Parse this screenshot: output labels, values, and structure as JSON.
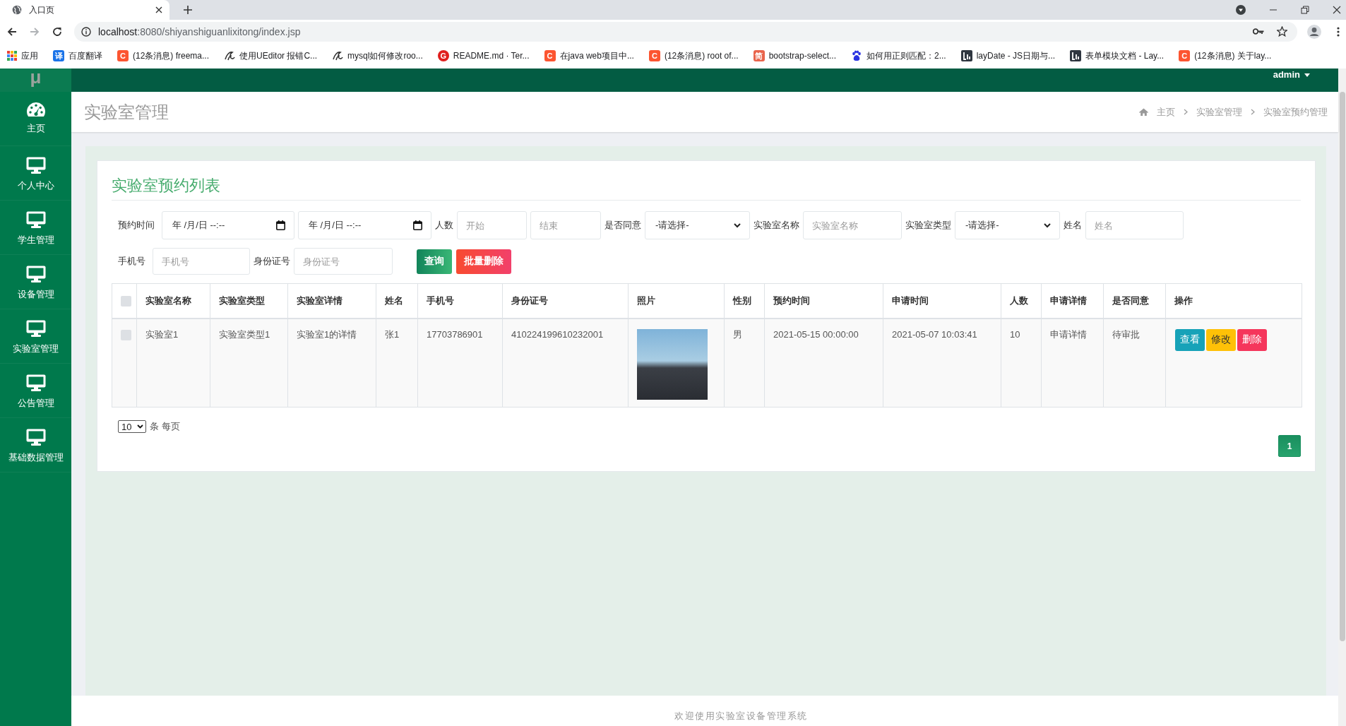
{
  "browser": {
    "tabs": [
      {
        "title": "入口页",
        "selected": true
      }
    ],
    "url": {
      "host": "localhost",
      "path": ":8080/shiyanshiguanlixitong/index.jsp"
    },
    "bookmarks": [
      {
        "kind": "apps",
        "label": "应用"
      },
      {
        "kind": "tile",
        "glyph": "译",
        "color": "#1a73e8",
        "label": "百度翻译"
      },
      {
        "kind": "tile",
        "glyph": "C",
        "color": "#fc5531",
        "label": "(12条消息) freema..."
      },
      {
        "kind": "swirl",
        "label": "使用UEditor 报错C..."
      },
      {
        "kind": "swirl",
        "label": "mysql如何修改roo..."
      },
      {
        "kind": "ring",
        "glyph": "G",
        "color": "#e0201e",
        "label": "README.md · Ter..."
      },
      {
        "kind": "tile",
        "glyph": "C",
        "color": "#fc5531",
        "label": "在java web项目中..."
      },
      {
        "kind": "tile",
        "glyph": "C",
        "color": "#fc5531",
        "label": "(12条消息) root of..."
      },
      {
        "kind": "tile",
        "glyph": "简",
        "color": "#e9644c",
        "label": "bootstrap-select..."
      },
      {
        "kind": "paw",
        "label": "如何用正则匹配：2..."
      },
      {
        "kind": "lay",
        "label": "layDate - JS日期与..."
      },
      {
        "kind": "lay",
        "label": "表单模块文档 - Lay..."
      },
      {
        "kind": "tile",
        "glyph": "C",
        "color": "#fc5531",
        "label": "(12条消息) 关于lay..."
      }
    ]
  },
  "topbar": {
    "logo": "μ",
    "user": "admin"
  },
  "sidebar": {
    "items": [
      {
        "kind": "gauge",
        "label": "主页",
        "selected": false
      },
      {
        "kind": "monitor",
        "label": "个人中心",
        "selected": false
      },
      {
        "kind": "monitor",
        "label": "学生管理",
        "selected": false
      },
      {
        "kind": "monitor",
        "label": "设备管理",
        "selected": false
      },
      {
        "kind": "monitor",
        "label": "实验室管理",
        "selected": false
      },
      {
        "kind": "monitor",
        "label": "公告管理",
        "selected": false
      },
      {
        "kind": "monitor",
        "label": "基础数据管理",
        "selected": false
      }
    ]
  },
  "page_header": {
    "title": "实验室管理",
    "breadcrumb": [
      "主页",
      "实验室管理",
      "实验室预约管理"
    ]
  },
  "card": {
    "title": "实验室预约列表",
    "filter_rows": [
      [
        {
          "kind": "label",
          "text": "预约时间"
        },
        {
          "kind": "date",
          "value": "年 /月/日 --:--"
        },
        {
          "kind": "date",
          "value": "年 /月/日 --:--"
        },
        {
          "kind": "label",
          "text": "人数"
        },
        {
          "kind": "input",
          "placeholder": "开始"
        },
        {
          "kind": "input",
          "placeholder": "结束"
        },
        {
          "kind": "label",
          "text": "是否同意"
        },
        {
          "kind": "select",
          "value": "-请选择-"
        },
        {
          "kind": "label",
          "text": "实验室名称"
        },
        {
          "kind": "input",
          "placeholder": "实验室名称"
        },
        {
          "kind": "label",
          "text": "实验室类型"
        },
        {
          "kind": "select",
          "value": "-请选择-"
        },
        {
          "kind": "label",
          "text": "姓名"
        },
        {
          "kind": "input",
          "placeholder": "姓名"
        }
      ],
      [
        {
          "kind": "label",
          "text": "手机号"
        },
        {
          "kind": "input",
          "placeholder": "手机号"
        },
        {
          "kind": "label",
          "text": "身份证号"
        },
        {
          "kind": "input",
          "placeholder": "身份证号"
        },
        {
          "kind": "search_button",
          "text": "查询"
        },
        {
          "kind": "delete_button",
          "text": "批量删除"
        }
      ]
    ]
  },
  "table": {
    "header_checked": false,
    "columns": [
      "实验室名称",
      "实验室类型",
      "实验室详情",
      "姓名",
      "手机号",
      "身份证号",
      "照片",
      "性别",
      "预约时间",
      "申请时间",
      "人数",
      "申请详情",
      "是否同意",
      "操作"
    ],
    "rows": [
      {
        "checked": false,
        "cells": [
          {
            "kind": "text",
            "text": "实验室1"
          },
          {
            "kind": "text",
            "text": "实验室类型1"
          },
          {
            "kind": "text",
            "text": "实验室1的详情"
          },
          {
            "kind": "text",
            "text": "张1"
          },
          {
            "kind": "text",
            "text": "17703786901"
          },
          {
            "kind": "text",
            "text": "410224199610232001"
          },
          {
            "kind": "photo"
          },
          {
            "kind": "text",
            "text": "男"
          },
          {
            "kind": "text",
            "text": "2021-05-15 00:00:00"
          },
          {
            "kind": "text",
            "text": "2021-05-07 10:03:41"
          },
          {
            "kind": "text",
            "text": "10"
          },
          {
            "kind": "text",
            "text": "申请详情"
          },
          {
            "kind": "text",
            "text": "待审批"
          },
          {
            "kind": "actions",
            "buttons": [
              {
                "kind": "view",
                "text": "查看"
              },
              {
                "kind": "edit",
                "text": "修改"
              },
              {
                "kind": "delete",
                "text": "删除"
              }
            ]
          }
        ]
      }
    ]
  },
  "pager": {
    "page_size": "10",
    "page_size_label": "条 每页",
    "pages": [
      {
        "label": "1",
        "selected": true
      }
    ]
  },
  "footer": {
    "text": "欢迎使用实验室设备管理系统"
  }
}
